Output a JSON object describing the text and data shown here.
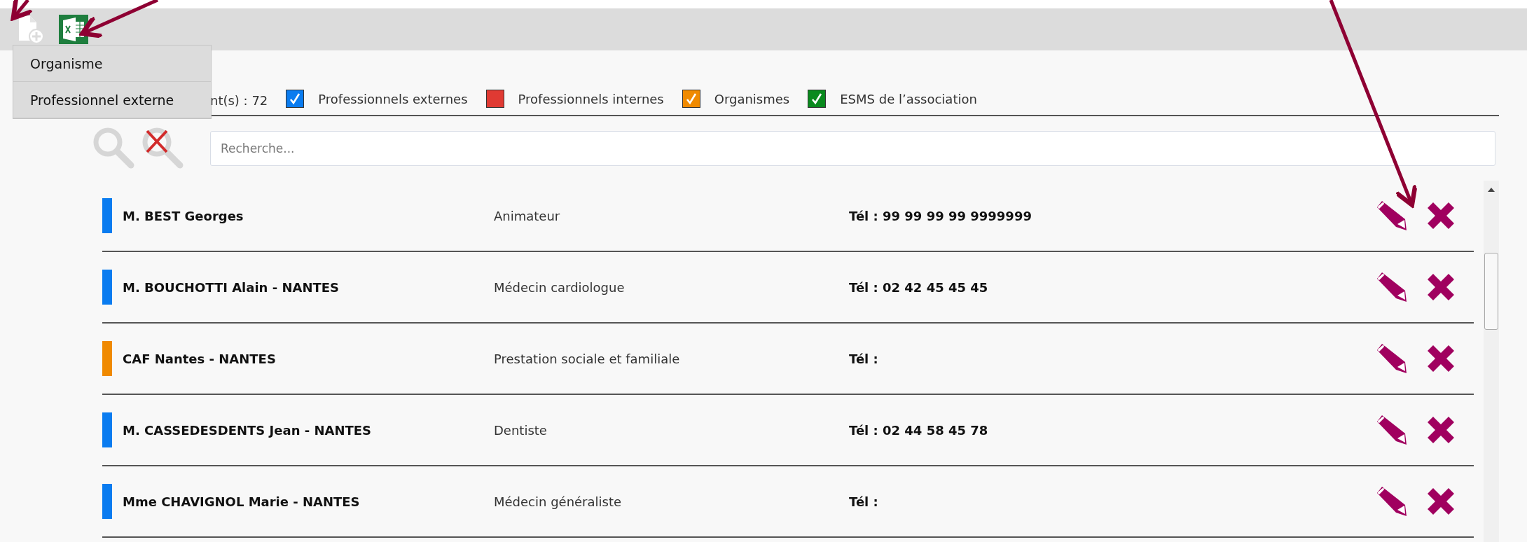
{
  "toolbar": {
    "menu": {
      "items": [
        {
          "label": "Organisme"
        },
        {
          "label": "Professionnel externe"
        }
      ]
    }
  },
  "legend": {
    "count": "nt(s) : 72",
    "items": [
      {
        "label": "Professionnels externes",
        "color": "#0a7cf0",
        "checked": true
      },
      {
        "label": "Professionnels internes",
        "color": "#e03a33",
        "checked": false
      },
      {
        "label": "Organismes",
        "color": "#f08a00",
        "checked": true
      },
      {
        "label": "ESMS de l’association",
        "color": "#0a8a1e",
        "checked": true
      }
    ]
  },
  "search": {
    "placeholder": "Recherche..."
  },
  "rows": [
    {
      "name": "M. BEST Georges",
      "role": "Animateur",
      "phone": "Tél : 99 99 99 99 9999999",
      "color": "#0a7cf0"
    },
    {
      "name": "M. BOUCHOTTI Alain - NANTES",
      "role": "Médecin cardiologue",
      "phone": "Tél : 02 42 45 45 45",
      "color": "#0a7cf0"
    },
    {
      "name": "CAF Nantes - NANTES",
      "role": "Prestation sociale et familiale",
      "phone": "Tél :",
      "color": "#f08a00"
    },
    {
      "name": "M. CASSEDESDENTS Jean - NANTES",
      "role": "Dentiste",
      "phone": "Tél : 02 44 58 45 78",
      "color": "#0a7cf0"
    },
    {
      "name": "Mme CHAVIGNOL Marie - NANTES",
      "role": "Médecin généraliste",
      "phone": "Tél :",
      "color": "#0a7cf0"
    }
  ]
}
